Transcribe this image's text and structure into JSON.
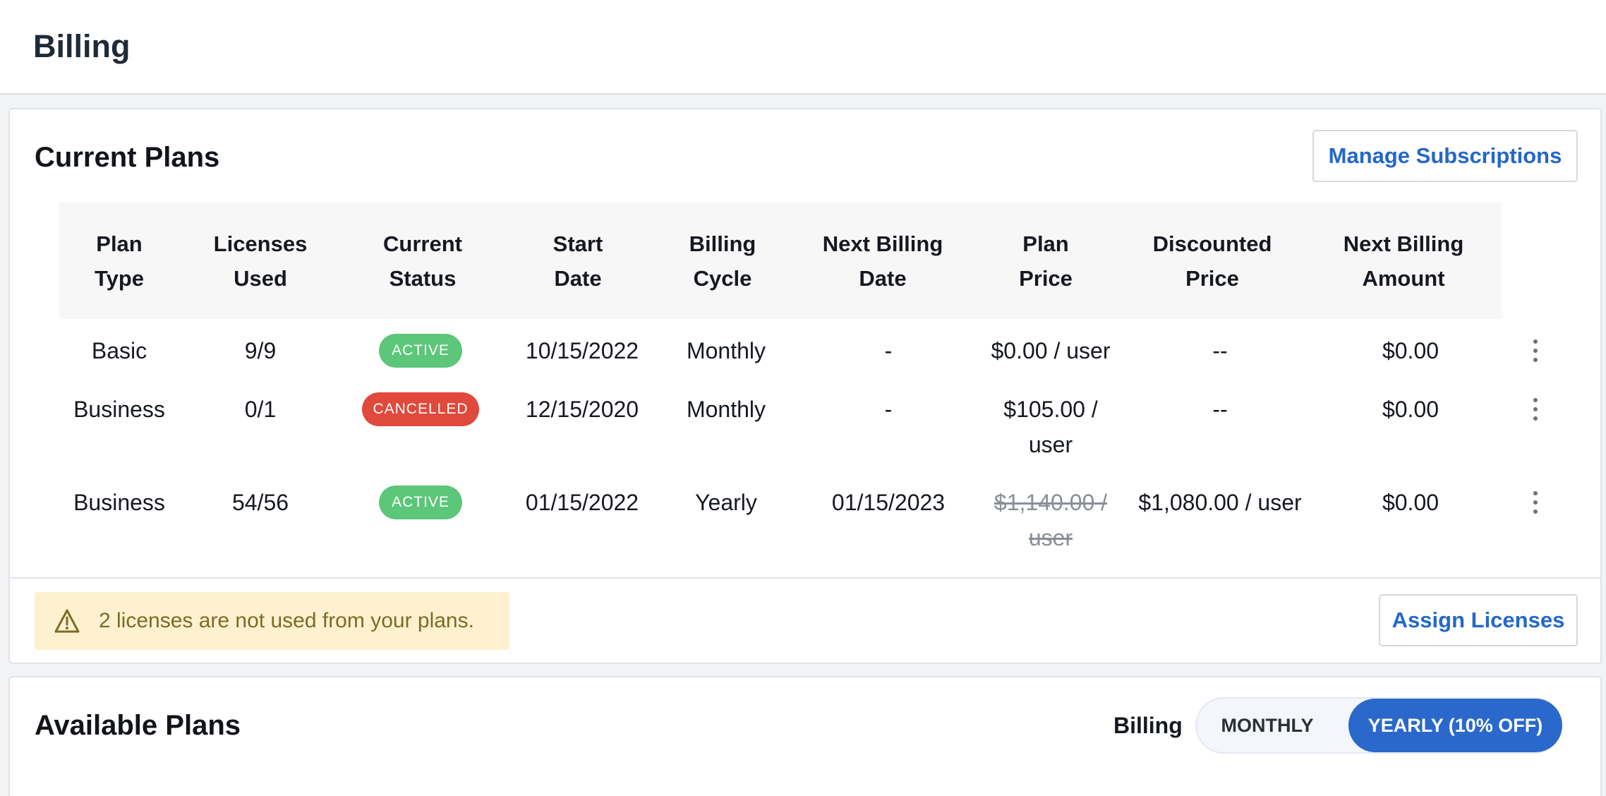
{
  "page": {
    "title": "Billing"
  },
  "current_plans": {
    "title": "Current Plans",
    "manage_button": "Manage Subscriptions",
    "columns": [
      [
        "Plan",
        "Type"
      ],
      [
        "Licenses",
        "Used"
      ],
      [
        "Current",
        "Status"
      ],
      [
        "Start",
        "Date"
      ],
      [
        "Billing",
        "Cycle"
      ],
      [
        "Next Billing",
        "Date"
      ],
      [
        "Plan",
        "Price"
      ],
      [
        "Discounted",
        "Price"
      ],
      [
        "Next Billing",
        "Amount"
      ]
    ],
    "rows": [
      {
        "plan_type": "Basic",
        "licenses": "9/9",
        "status": "ACTIVE",
        "start": "10/15/2022",
        "cycle": "Monthly",
        "next_date": "-",
        "price": [
          "$0.00 / user"
        ],
        "discounted": "--",
        "amount": "$0.00"
      },
      {
        "plan_type": "Business",
        "licenses": "0/1",
        "status": "CANCELLED",
        "start": "12/15/2020",
        "cycle": "Monthly",
        "next_date": "-",
        "price": [
          "$105.00 /",
          "user"
        ],
        "discounted": "--",
        "amount": "$0.00"
      },
      {
        "plan_type": "Business",
        "licenses": "54/56",
        "status": "ACTIVE",
        "start": "01/15/2022",
        "cycle": "Yearly",
        "next_date": "01/15/2023",
        "price": [
          "$1,140.00 /",
          "user"
        ],
        "discounted": "$1,080.00 / user",
        "amount": "$0.00"
      }
    ],
    "warning_text": "2 licenses are not used from your plans.",
    "assign_button": "Assign Licenses"
  },
  "available_plans": {
    "title": "Available Plans",
    "billing_label": "Billing",
    "toggle": {
      "monthly": "MONTHLY",
      "yearly": "YEARLY (10% OFF)",
      "selected": "yearly"
    }
  },
  "colors": {
    "accent": "#2a69cb",
    "active": "#5cc679",
    "cancelled": "#e0493b",
    "warning_bg": "#fdf1cf",
    "warning_text": "#7d6a25"
  }
}
